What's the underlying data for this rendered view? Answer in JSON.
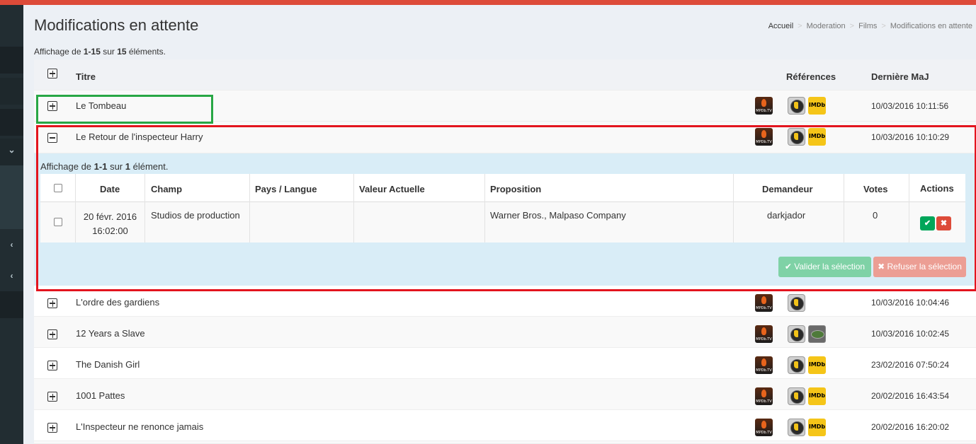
{
  "header": {
    "title": "Modifications en attente",
    "breadcrumb": [
      "Accueil",
      "Moderation",
      "Films",
      "Modifications en attente"
    ],
    "summary_prefix": "Affichage de ",
    "summary_range": "1-15",
    "summary_mid": " sur ",
    "summary_total": "15",
    "summary_suffix": " éléments."
  },
  "table": {
    "col_title": "Titre",
    "col_refs": "Références",
    "col_updated": "Dernière MaJ",
    "rows": [
      {
        "title": "Le Tombeau",
        "updated": "10/03/2016 10:11:56",
        "expanded": false,
        "refs": [
          "allocine",
          "imdb"
        ]
      },
      {
        "title": "Le Retour de l'inspecteur Harry",
        "updated": "10/03/2016 10:10:29",
        "expanded": true,
        "refs": [
          "allocine",
          "imdb"
        ]
      },
      {
        "title": "L'ordre des gardiens",
        "updated": "10/03/2016 10:04:46",
        "expanded": false,
        "refs": [
          "allocine"
        ]
      },
      {
        "title": "12 Years a Slave",
        "updated": "10/03/2016 10:02:45",
        "expanded": false,
        "refs": [
          "allocine",
          "other"
        ]
      },
      {
        "title": "The Danish Girl",
        "updated": "23/02/2016 07:50:24",
        "expanded": false,
        "refs": [
          "allocine",
          "imdb"
        ]
      },
      {
        "title": "1001 Pattes",
        "updated": "20/02/2016 16:43:54",
        "expanded": false,
        "refs": [
          "allocine",
          "imdb"
        ]
      },
      {
        "title": "L'Inspecteur ne renonce jamais",
        "updated": "20/02/2016 16:20:02",
        "expanded": false,
        "refs": [
          "allocine",
          "imdb"
        ]
      }
    ],
    "mpdb_label": "MPDb.TV",
    "imdb_label": "IMDb"
  },
  "detail": {
    "summary_prefix": "Affichage de ",
    "summary_range": "1-1",
    "summary_mid": " sur ",
    "summary_total": "1",
    "summary_suffix": " élément.",
    "headers": {
      "date": "Date",
      "field": "Champ",
      "country": "Pays / Langue",
      "current": "Valeur Actuelle",
      "proposal": "Proposition",
      "requester": "Demandeur",
      "votes": "Votes",
      "actions": "Actions"
    },
    "row": {
      "date_line1": "20 févr. 2016",
      "date_line2": "16:02:00",
      "field": "Studios de production",
      "country": "",
      "current": "",
      "proposal": "Warner Bros., Malpaso Company",
      "requester": "darkjador",
      "votes": "0"
    },
    "validate_label": "✔ Valider la sélection",
    "refuse_label": "✖ Refuser la sélection"
  },
  "colors": {
    "topbar": "#dd4b39",
    "sidebar": "#222d32",
    "detail_bg": "#d9edf7",
    "outline_green": "#28a745",
    "outline_red": "#e3141e"
  }
}
